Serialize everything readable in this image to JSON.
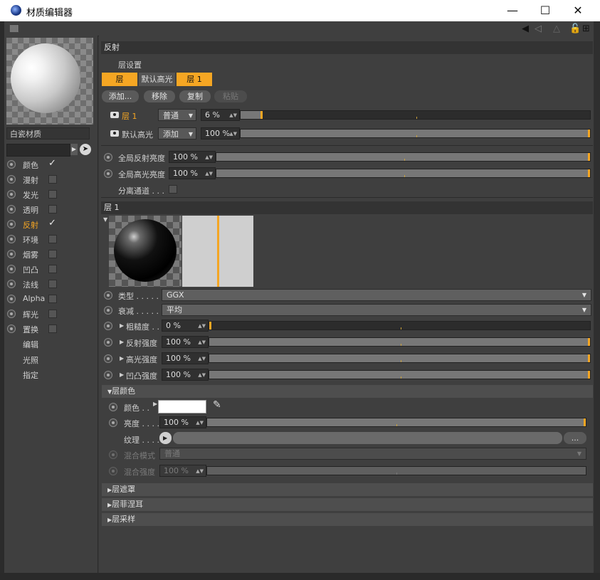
{
  "window": {
    "title": "材质编辑器",
    "minimize": "—",
    "maximize": "☐",
    "close": "✕"
  },
  "material": {
    "name": "白瓷材质",
    "channels": [
      {
        "label": "颜色",
        "checked": true
      },
      {
        "label": "漫射",
        "checked": false
      },
      {
        "label": "发光",
        "checked": false
      },
      {
        "label": "透明",
        "checked": false
      },
      {
        "label": "反射",
        "checked": true,
        "active": true
      },
      {
        "label": "环境",
        "checked": false
      },
      {
        "label": "烟雾",
        "checked": false
      },
      {
        "label": "凹凸",
        "checked": false
      },
      {
        "label": "法线",
        "checked": false
      },
      {
        "label": "Alpha",
        "checked": false
      },
      {
        "label": "辉光",
        "checked": false
      },
      {
        "label": "置换",
        "checked": false
      }
    ],
    "extra": [
      "编辑",
      "光照",
      "指定"
    ]
  },
  "reflect": {
    "header": "反射",
    "layer_settings": "层设置",
    "tabs": [
      "层",
      "默认高光",
      "层 1"
    ],
    "buttons": [
      "添加...",
      "移除",
      "复制",
      "粘贴"
    ],
    "layers": [
      {
        "name": "层 1",
        "mode": "普通",
        "value": "6 %",
        "fraction": 0.06
      },
      {
        "name": "默认高光",
        "mode": "添加",
        "value": "100 %",
        "fraction": 1.0
      }
    ],
    "global_reflect_label": "全局反射亮度",
    "global_reflect_value": "100 %",
    "global_spec_label": "全局高光亮度",
    "global_spec_value": "100 %",
    "separate_pass": "分离通道 . . ."
  },
  "layer1": {
    "header": "层 1",
    "type_label": "类型 . . . . . .",
    "type_value": "GGX",
    "atten_label": "衰减 . . . . . . .",
    "atten_value": "平均",
    "rough_label": "粗糙度 . . . . .",
    "rough_value": "0 %",
    "reflect_label": "反射强度",
    "reflect_value": "100 %",
    "spec_label": "高光强度",
    "spec_value": "100 %",
    "bump_label": "凹凸强度",
    "bump_value": "100 %"
  },
  "layer_color": {
    "header": "层颜色",
    "color_label": "颜色 . .",
    "brightness_label": "亮度 . . . .",
    "brightness_value": "100 %",
    "texture_label": "纹理 . . . . .",
    "texture_more": "...",
    "blend_mode_label": "混合模式",
    "blend_mode_value": "普通",
    "blend_strength_label": "混合强度",
    "blend_strength_value": "100 %"
  },
  "collapsed": [
    "层遮罩",
    "层菲涅耳",
    "层采样"
  ],
  "colors": {
    "accent": "#f5a623",
    "panel": "#3f3f3f"
  }
}
